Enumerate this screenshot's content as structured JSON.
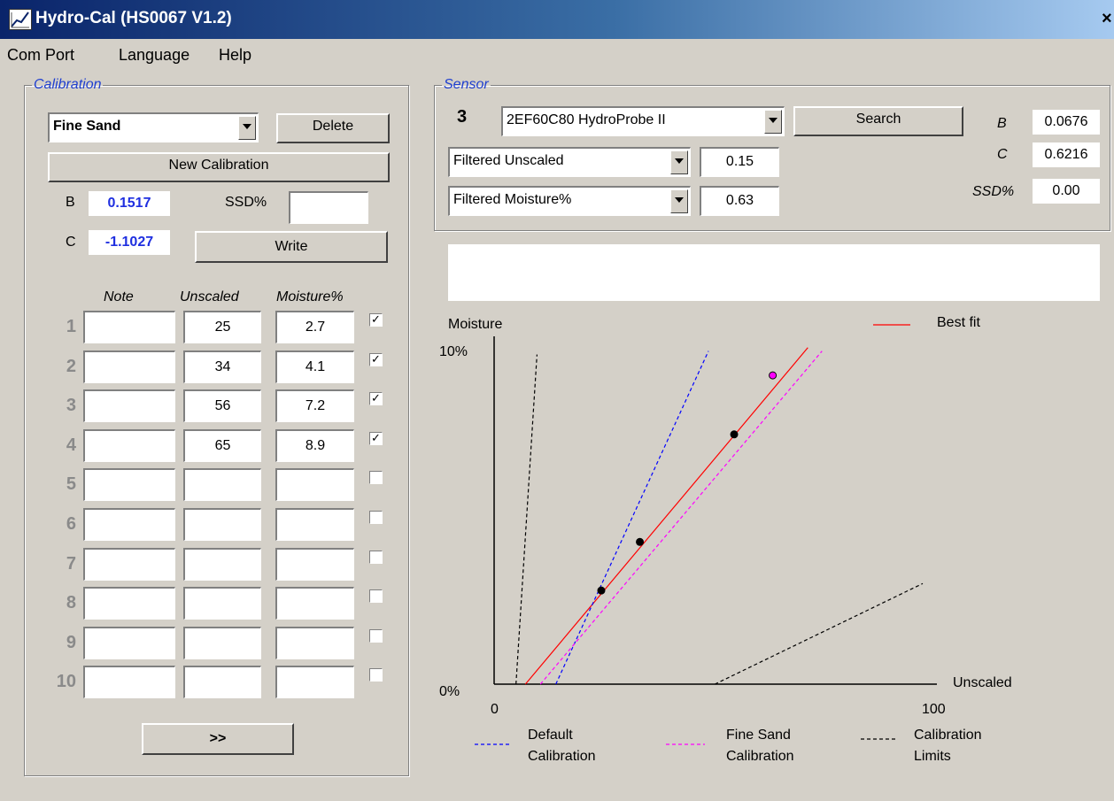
{
  "window": {
    "title": "Hydro-Cal (HS0067 V1.2)",
    "close": "×"
  },
  "menu": [
    "Com Port",
    "Language",
    "Help"
  ],
  "calibration": {
    "legend": "Calibration",
    "selected": "Fine Sand",
    "delete_label": "Delete",
    "new_label": "New Calibration",
    "b_label": "B",
    "b_value": "0.1517",
    "c_label": "C",
    "c_value": "-1.1027",
    "ssd_label": "SSD%",
    "ssd_value": "",
    "write_label": "Write",
    "headers": {
      "note": "Note",
      "unscaled": "Unscaled",
      "moisture": "Moisture%"
    },
    "rows": [
      {
        "num": "1",
        "note": "",
        "unscaled": "25",
        "moisture": "2.7",
        "checked": true
      },
      {
        "num": "2",
        "note": "",
        "unscaled": "34",
        "moisture": "4.1",
        "checked": true
      },
      {
        "num": "3",
        "note": "",
        "unscaled": "56",
        "moisture": "7.2",
        "checked": true
      },
      {
        "num": "4",
        "note": "",
        "unscaled": "65",
        "moisture": "8.9",
        "checked": true
      },
      {
        "num": "5",
        "note": "",
        "unscaled": "",
        "moisture": "",
        "checked": false
      },
      {
        "num": "6",
        "note": "",
        "unscaled": "",
        "moisture": "",
        "checked": false
      },
      {
        "num": "7",
        "note": "",
        "unscaled": "",
        "moisture": "",
        "checked": false
      },
      {
        "num": "8",
        "note": "",
        "unscaled": "",
        "moisture": "",
        "checked": false
      },
      {
        "num": "9",
        "note": "",
        "unscaled": "",
        "moisture": "",
        "checked": false
      },
      {
        "num": "10",
        "note": "",
        "unscaled": "",
        "moisture": "",
        "checked": false
      }
    ],
    "next_label": ">>"
  },
  "sensor": {
    "legend": "Sensor",
    "address": "3",
    "selected": "2EF60C80 HydroProbe II",
    "search_label": "Search",
    "output1": {
      "mode": "Filtered Unscaled",
      "value": "0.15"
    },
    "output2": {
      "mode": "Filtered Moisture%",
      "value": "0.63"
    },
    "b_label": "B",
    "b_value": "0.0676",
    "c_label": "C",
    "c_value": "0.6216",
    "ssd_label": "SSD%",
    "ssd_value": "0.00"
  },
  "message": "",
  "chart_data": {
    "type": "line",
    "ylabel": "Moisture",
    "xlabel": "Unscaled",
    "x_ticks": [
      "0",
      "100"
    ],
    "y_ticks": [
      "0%",
      "10%"
    ],
    "xlim": [
      0,
      100
    ],
    "ylim": [
      0,
      10
    ],
    "legend": {
      "best_fit": "Best fit",
      "default": [
        "Default",
        "Calibration"
      ],
      "fine_sand": [
        "Fine Sand",
        "Calibration"
      ],
      "limits": [
        "Calibration",
        "Limits"
      ]
    },
    "series": [
      {
        "name": "Best fit",
        "color": "#ff0000",
        "style": "solid",
        "x": [
          7.3,
          73.2
        ],
        "y": [
          0,
          9.7
        ]
      },
      {
        "name": "Default Calibration",
        "color": "#0000ff",
        "style": "dashed",
        "x": [
          14.4,
          50.0
        ],
        "y": [
          0,
          9.6
        ]
      },
      {
        "name": "Fine Sand Calibration",
        "color": "#ff00ff",
        "style": "dashed",
        "x": [
          10.8,
          76.5
        ],
        "y": [
          0,
          9.6
        ]
      },
      {
        "name": "Calibration Limits",
        "color": "#000000",
        "style": "dashed",
        "x": [
          5.1,
          10.0
        ],
        "y": [
          0,
          9.5
        ]
      },
      {
        "name": "Calibration Limits",
        "color": "#000000",
        "style": "dashed",
        "x": [
          51.5,
          100.0
        ],
        "y": [
          0,
          2.9
        ]
      }
    ],
    "points": [
      {
        "x": 25,
        "y": 2.7,
        "color": "#000000"
      },
      {
        "x": 34,
        "y": 4.1,
        "color": "#000000"
      },
      {
        "x": 56,
        "y": 7.2,
        "color": "#000000"
      },
      {
        "x": 65,
        "y": 8.9,
        "color": "#ff00ff"
      }
    ]
  }
}
